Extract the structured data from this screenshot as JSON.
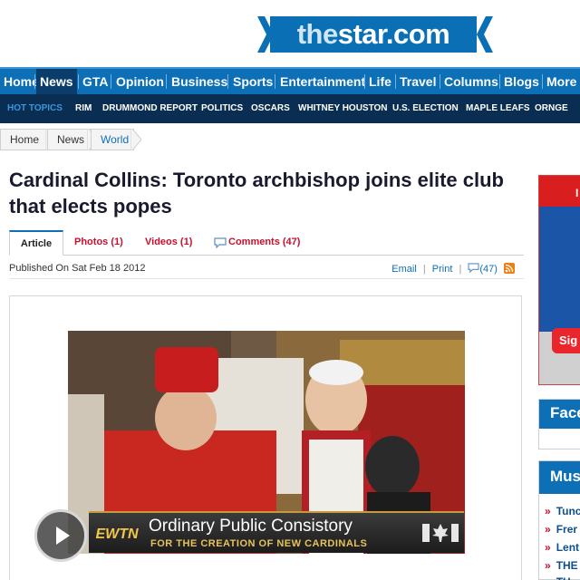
{
  "logo": {
    "text_prefix": "the",
    "text_main": "star.com",
    "brand_color": "#0a6fb5"
  },
  "nav": {
    "items": [
      "Home",
      "News",
      "GTA",
      "Opinion",
      "Business",
      "Sports",
      "Entertainment",
      "Life",
      "Travel",
      "Columns",
      "Blogs",
      "More"
    ],
    "active": "News"
  },
  "hot_topics": {
    "label": "HOT TOPICS",
    "items": [
      "RIM",
      "DRUMMOND REPORT",
      "POLITICS",
      "OSCARS",
      "WHITNEY HOUSTON",
      "U.S. ELECTION",
      "MAPLE LEAFS",
      "ORNGE"
    ]
  },
  "breadcrumb": [
    "Home",
    "News",
    "World"
  ],
  "article": {
    "headline": "Cardinal Collins: Toronto archbishop joins elite club that elects popes",
    "tabs": {
      "article": "Article",
      "photos": "Photos (1)",
      "videos": "Videos (1)",
      "comments": "Comments (47)"
    },
    "published": "Published On Sat Feb 18 2012",
    "links": {
      "email": "Email",
      "print": "Print",
      "comments_count": "(47)"
    }
  },
  "video": {
    "network": "EWTN",
    "caption_title": "Ordinary Public Consistory",
    "caption_subtitle": "FOR THE CREATION OF NEW CARDINALS"
  },
  "rail": {
    "ad_button": "Sig",
    "ad_letter": "I",
    "facebook_heading": "Face",
    "must_heading": "Mus",
    "must_items": [
      "Tunc",
      "Frer",
      "Lent",
      "THE",
      "TH"
    ]
  }
}
